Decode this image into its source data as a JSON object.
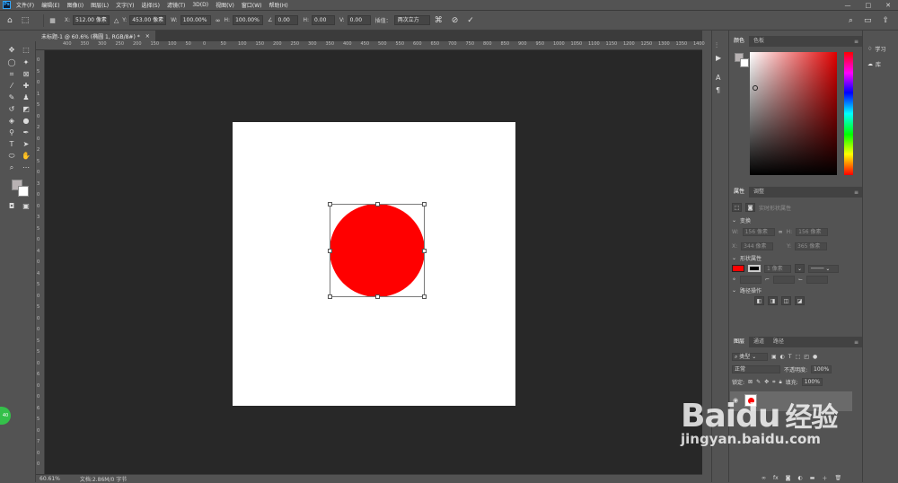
{
  "menubar": {
    "app_icon": "Ps",
    "items": [
      "文件(F)",
      "编辑(E)",
      "图像(I)",
      "图层(L)",
      "文字(Y)",
      "选择(S)",
      "滤镜(T)",
      "3D(D)",
      "视图(V)",
      "窗口(W)",
      "帮助(H)"
    ],
    "window_buttons": [
      "—",
      "□",
      "✕"
    ]
  },
  "options": {
    "x_label": "X:",
    "x_value": "512.00 像素",
    "y_label": "Y:",
    "y_value": "453.00 像素",
    "w_label": "W:",
    "w_value": "100.00%",
    "h_label": "H:",
    "h_value": "100.00%",
    "angle_value": "0.00",
    "hskew_label": "H:",
    "hskew_value": "0.00",
    "vskew_label": "V:",
    "vskew_value": "0.00",
    "interp_label": "插值：",
    "interp_value": "两次立方"
  },
  "document_tab": {
    "title": "未标题-1 @ 60.6% (椭圆 1, RGB/8#) *",
    "close": "×"
  },
  "ruler_h": [
    "400",
    "350",
    "300",
    "250",
    "200",
    "150",
    "100",
    "50",
    "0",
    "50",
    "100",
    "150",
    "200",
    "250",
    "300",
    "350",
    "400",
    "450",
    "500",
    "550",
    "600",
    "650",
    "700",
    "750",
    "800",
    "850",
    "900",
    "950",
    "1000",
    "1050",
    "1100",
    "1150",
    "1200",
    "1250",
    "1300",
    "1350",
    "1400"
  ],
  "ruler_v": [
    "0",
    "5",
    "0",
    "1",
    "5",
    "0",
    "2",
    "0",
    "2",
    "5",
    "0",
    "3",
    "0",
    "0",
    "3",
    "5",
    "0",
    "4",
    "0",
    "4",
    "5",
    "0",
    "5",
    "0",
    "0",
    "5",
    "5",
    "0",
    "6",
    "0",
    "0",
    "6",
    "5",
    "0",
    "7",
    "0",
    "0"
  ],
  "status": {
    "zoom": "60.61%",
    "doc": "文档:2.86M/0 字节"
  },
  "panels": {
    "color_tabs": [
      "颜色",
      "色板"
    ],
    "props_tabs": [
      "属性",
      "调整"
    ],
    "props_title": "实时形状属性",
    "section_transform": "变换",
    "w_label": "W:",
    "w_value": "156 像素",
    "h_label": "H:",
    "h_value": "156 像素",
    "x_label": "X:",
    "x_value": "344 像素",
    "y_label": "Y:",
    "y_value": "365 像素",
    "section_shape": "形状属性",
    "stroke_width": "1 像素",
    "section_path": "路径操作",
    "layers_tabs": [
      "图层",
      "通道",
      "路径"
    ],
    "layer_filter": "类型",
    "blend_mode": "正常",
    "opacity_label": "不透明度:",
    "opacity_value": "100%",
    "lock_label": "锁定:",
    "fill_label": "填充:",
    "fill_value": "100%",
    "fg_color": "#b8b2b3",
    "fill_color": "#ff0000"
  },
  "right_panel": {
    "learn": "学习",
    "library": "库"
  },
  "watermark": {
    "brand": "Bai",
    "paw": "du",
    "chinese": "经验",
    "url": "jingyan.baidu.com"
  },
  "badge": "40"
}
